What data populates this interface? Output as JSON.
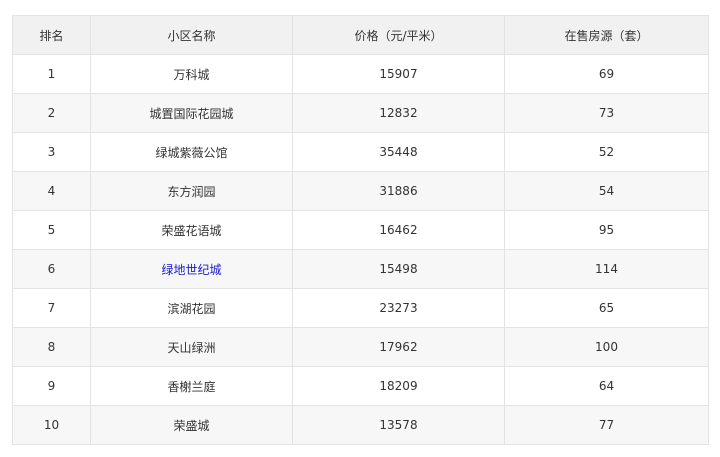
{
  "table": {
    "headers": [
      "排名",
      "小区名称",
      "价格（元/平米）",
      "在售房源（套）"
    ],
    "rows": [
      {
        "rank": "1",
        "name": "万科城",
        "price": "15907",
        "count": "69",
        "link": false
      },
      {
        "rank": "2",
        "name": "城置国际花园城",
        "price": "12832",
        "count": "73",
        "link": false
      },
      {
        "rank": "3",
        "name": "绿城紫薇公馆",
        "price": "35448",
        "count": "52",
        "link": false
      },
      {
        "rank": "4",
        "name": "东方润园",
        "price": "31886",
        "count": "54",
        "link": false
      },
      {
        "rank": "5",
        "name": "荣盛花语城",
        "price": "16462",
        "count": "95",
        "link": false
      },
      {
        "rank": "6",
        "name": "绿地世纪城",
        "price": "15498",
        "count": "114",
        "link": true
      },
      {
        "rank": "7",
        "name": "滨湖花园",
        "price": "23273",
        "count": "65",
        "link": false
      },
      {
        "rank": "8",
        "name": "天山绿洲",
        "price": "17962",
        "count": "100",
        "link": false
      },
      {
        "rank": "9",
        "name": "香榭兰庭",
        "price": "18209",
        "count": "64",
        "link": false
      },
      {
        "rank": "10",
        "name": "荣盛城",
        "price": "13578",
        "count": "77",
        "link": false
      }
    ]
  },
  "colors": {
    "header_bg": "#f1f1f1",
    "alt_row_bg": "#f7f7f7",
    "border": "#e3e3e3",
    "link": "#1a1ad0",
    "text": "#333333"
  }
}
